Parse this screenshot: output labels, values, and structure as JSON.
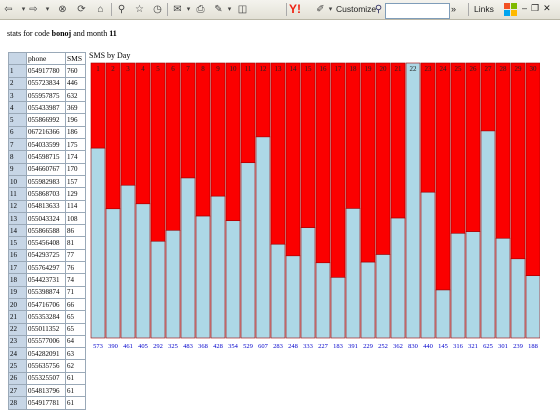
{
  "toolbar": {
    "customize_label": "Customize",
    "links_label": "Links",
    "more_label": "»",
    "search_value": ""
  },
  "heading": {
    "prefix": "stats for code",
    "code": "bonoj",
    "middle": "and month",
    "month": "11"
  },
  "table": {
    "col_phone": "phone",
    "col_sms": "SMS",
    "rows": [
      {
        "n": "1",
        "phone": "054917780",
        "sms": "760"
      },
      {
        "n": "2",
        "phone": "055723834",
        "sms": "446"
      },
      {
        "n": "3",
        "phone": "055957875",
        "sms": "632"
      },
      {
        "n": "4",
        "phone": "055433987",
        "sms": "369"
      },
      {
        "n": "5",
        "phone": "055866992",
        "sms": "196"
      },
      {
        "n": "6",
        "phone": "067216366",
        "sms": "186"
      },
      {
        "n": "7",
        "phone": "054033599",
        "sms": "175"
      },
      {
        "n": "8",
        "phone": "054598715",
        "sms": "174"
      },
      {
        "n": "9",
        "phone": "054660767",
        "sms": "170"
      },
      {
        "n": "10",
        "phone": "055982983",
        "sms": "157"
      },
      {
        "n": "11",
        "phone": "055868703",
        "sms": "129"
      },
      {
        "n": "12",
        "phone": "054813633",
        "sms": "114"
      },
      {
        "n": "13",
        "phone": "055043324",
        "sms": "108"
      },
      {
        "n": "14",
        "phone": "055866588",
        "sms": "86"
      },
      {
        "n": "15",
        "phone": "055456408",
        "sms": "81"
      },
      {
        "n": "16",
        "phone": "054293725",
        "sms": "77"
      },
      {
        "n": "17",
        "phone": "055764297",
        "sms": "76"
      },
      {
        "n": "18",
        "phone": "054423731",
        "sms": "74"
      },
      {
        "n": "19",
        "phone": "055398874",
        "sms": "71"
      },
      {
        "n": "20",
        "phone": "054716706",
        "sms": "66"
      },
      {
        "n": "21",
        "phone": "055353284",
        "sms": "65"
      },
      {
        "n": "22",
        "phone": "055011352",
        "sms": "65"
      },
      {
        "n": "23",
        "phone": "055577006",
        "sms": "64"
      },
      {
        "n": "24",
        "phone": "054282091",
        "sms": "63"
      },
      {
        "n": "25",
        "phone": "055635756",
        "sms": "62"
      },
      {
        "n": "26",
        "phone": "055325507",
        "sms": "61"
      },
      {
        "n": "27",
        "phone": "054813796",
        "sms": "61"
      },
      {
        "n": "28",
        "phone": "054917781",
        "sms": "61"
      }
    ]
  },
  "chart_data": {
    "type": "bar",
    "title": "SMS by Day",
    "categories": [
      "1",
      "2",
      "3",
      "4",
      "5",
      "6",
      "7",
      "8",
      "9",
      "10",
      "11",
      "12",
      "13",
      "14",
      "15",
      "16",
      "17",
      "18",
      "19",
      "20",
      "21",
      "22",
      "23",
      "24",
      "25",
      "26",
      "27",
      "28",
      "29",
      "30"
    ],
    "values": [
      573,
      390,
      461,
      405,
      292,
      325,
      483,
      368,
      428,
      354,
      529,
      607,
      283,
      248,
      333,
      227,
      183,
      391,
      229,
      252,
      362,
      830,
      440,
      145,
      316,
      321,
      625,
      301,
      239,
      188
    ],
    "ylim": [
      0,
      830
    ],
    "colors": {
      "filled": "#add8e6",
      "remainder": "#fb0000",
      "value_text": "#0000cc"
    }
  }
}
